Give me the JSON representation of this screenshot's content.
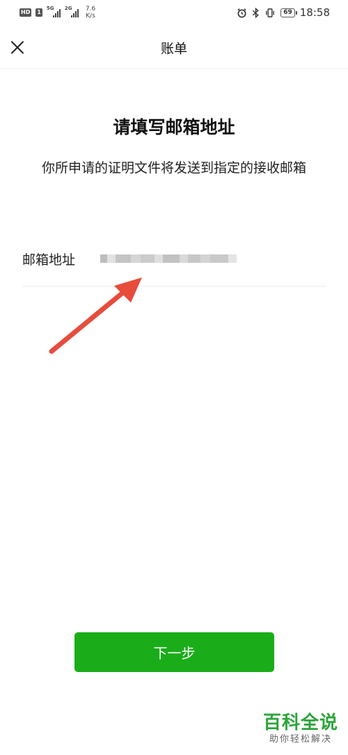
{
  "status_bar": {
    "hd_badge": "HD",
    "sim1": "1",
    "net1": "5G",
    "net2": "2G",
    "speed_value": "7.6",
    "speed_unit": "K/s",
    "battery": "69",
    "time": "18:58",
    "icons": [
      "alarm-icon",
      "bluetooth-icon",
      "vibrate-icon",
      "battery-icon"
    ]
  },
  "nav": {
    "title": "账单",
    "close_icon": "close-icon"
  },
  "main": {
    "heading": "请填写邮箱地址",
    "description": "你所申请的证明文件将发送到指定的接收邮箱",
    "email_field": {
      "label": "邮箱地址",
      "value": "",
      "placeholder": ""
    }
  },
  "footer": {
    "next_button_label": "下一步"
  },
  "watermark": {
    "title": "百科全说",
    "subtitle": "助你轻松解决"
  },
  "colors": {
    "primary_green": "#1aad19",
    "annotation_arrow": "#e74c3c",
    "watermark_green": "#2ca43a"
  }
}
